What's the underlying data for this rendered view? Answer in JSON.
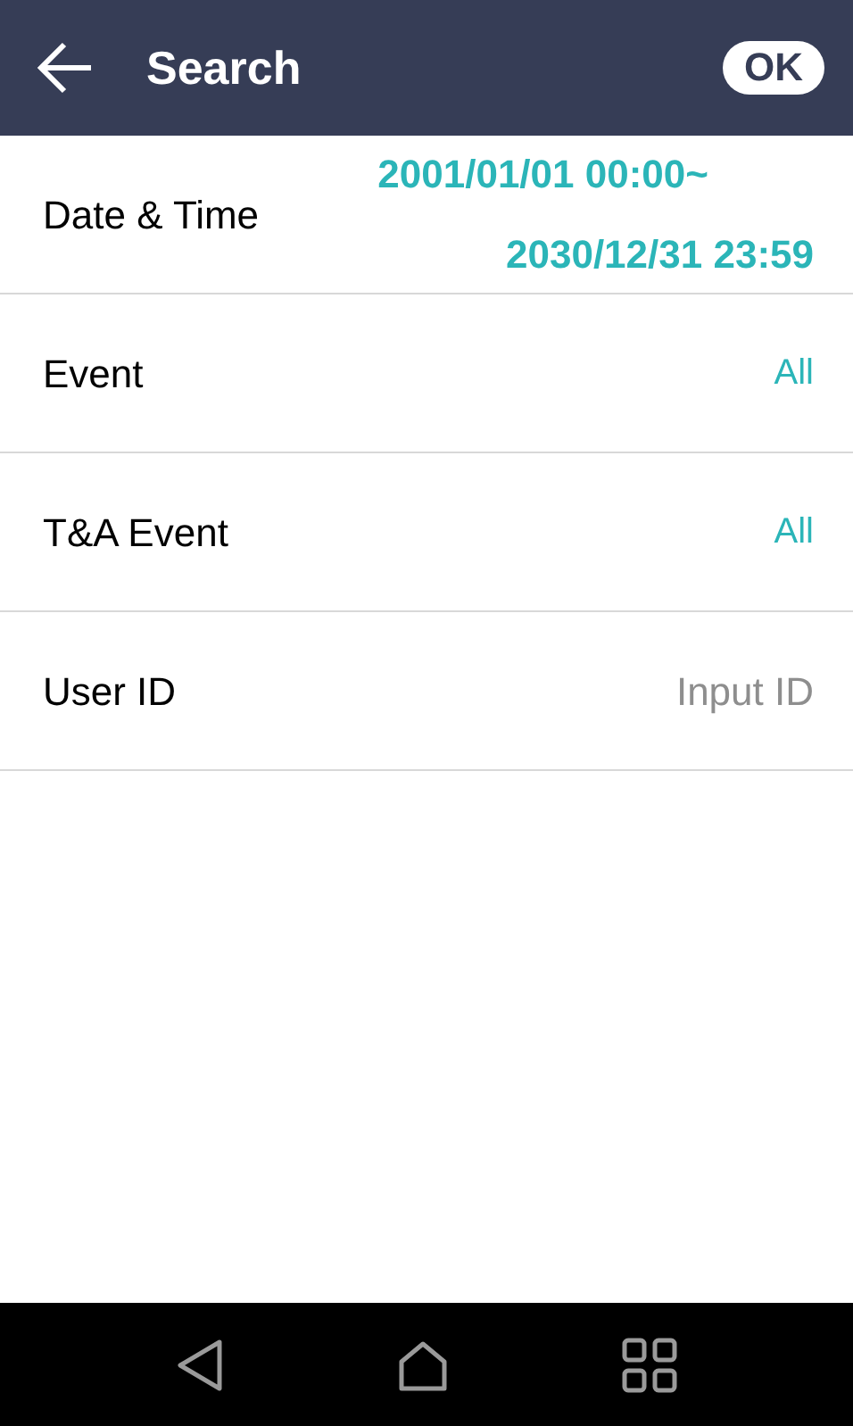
{
  "header": {
    "title": "Search",
    "ok_button": "OK"
  },
  "rows": [
    {
      "kind": "date_range",
      "label": "Date & Time",
      "start": "2001/01/01 00:00~",
      "end": "2030/12/31 23:59"
    },
    {
      "kind": "value",
      "label": "Event",
      "value": "All"
    },
    {
      "kind": "value",
      "label": "T&A Event",
      "value": "All"
    },
    {
      "kind": "input",
      "label": "User ID",
      "placeholder": "Input ID"
    }
  ]
}
